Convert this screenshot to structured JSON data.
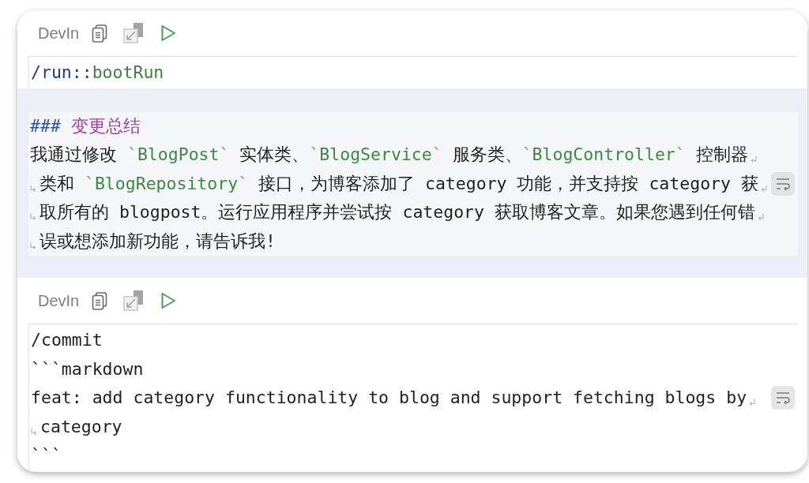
{
  "conversation": [
    {
      "kind": "prompt",
      "header": {
        "title": "DevIn"
      },
      "lines": [
        {
          "wrapped": false,
          "wrap_button": false,
          "segments": [
            {
              "kind": "command",
              "text": "/run"
            },
            {
              "kind": "separator",
              "text": "::"
            },
            {
              "kind": "argument",
              "text": "bootRun"
            }
          ]
        }
      ]
    },
    {
      "kind": "reply",
      "lines": [
        {
          "wrapped": false,
          "wrap_button": false,
          "segments": [
            {
              "kind": "heading_mark",
              "text": "###"
            },
            {
              "kind": "heading",
              "text": " 变更总结"
            }
          ]
        },
        {
          "wrapped": true,
          "wrap_button": false,
          "segments": [
            {
              "kind": "text",
              "text": "我通过修改 "
            },
            {
              "kind": "tick",
              "text": "`"
            },
            {
              "kind": "code",
              "text": "BlogPost"
            },
            {
              "kind": "tick",
              "text": "`"
            },
            {
              "kind": "text",
              "text": " 实体类、"
            },
            {
              "kind": "tick",
              "text": "`"
            },
            {
              "kind": "code",
              "text": "BlogService"
            },
            {
              "kind": "tick",
              "text": "`"
            },
            {
              "kind": "text",
              "text": " 服务类、"
            },
            {
              "kind": "tick",
              "text": "`"
            },
            {
              "kind": "code",
              "text": "BlogController"
            },
            {
              "kind": "tick",
              "text": "`"
            },
            {
              "kind": "text",
              "text": " 控制器"
            }
          ]
        },
        {
          "wrapped": true,
          "wrap_button": true,
          "segments": [
            {
              "kind": "text",
              "text": "类和 "
            },
            {
              "kind": "tick",
              "text": "`"
            },
            {
              "kind": "code",
              "text": "BlogRepository"
            },
            {
              "kind": "tick",
              "text": "`"
            },
            {
              "kind": "text",
              "text": " 接口，为博客添加了 category 功能，并支持按 category 获"
            }
          ]
        },
        {
          "wrapped": true,
          "wrap_button": false,
          "segments": [
            {
              "kind": "text",
              "text": "取所有的 blogpost。运行应用程序并尝试按 category 获取博客文章。如果您遇到任何错"
            }
          ]
        },
        {
          "wrapped": false,
          "wrap_button": false,
          "segments": [
            {
              "kind": "text",
              "text": "误或想添加新功能，请告诉我!"
            }
          ]
        }
      ]
    },
    {
      "kind": "prompt",
      "header": {
        "title": "DevIn"
      },
      "lines": [
        {
          "wrapped": false,
          "wrap_button": false,
          "segments": [
            {
              "kind": "text",
              "text": "/commit"
            }
          ]
        },
        {
          "wrapped": false,
          "wrap_button": false,
          "segments": [
            {
              "kind": "text",
              "text": "```markdown"
            }
          ]
        },
        {
          "wrapped": true,
          "wrap_button": true,
          "segments": [
            {
              "kind": "text",
              "text": "feat: add category functionality to blog and support fetching blogs by"
            }
          ]
        },
        {
          "wrapped": false,
          "wrap_button": false,
          "segments": [
            {
              "kind": "text",
              "text": "category"
            }
          ]
        },
        {
          "wrapped": false,
          "wrap_button": false,
          "segments": [
            {
              "kind": "text",
              "text": "```"
            }
          ]
        }
      ]
    }
  ]
}
